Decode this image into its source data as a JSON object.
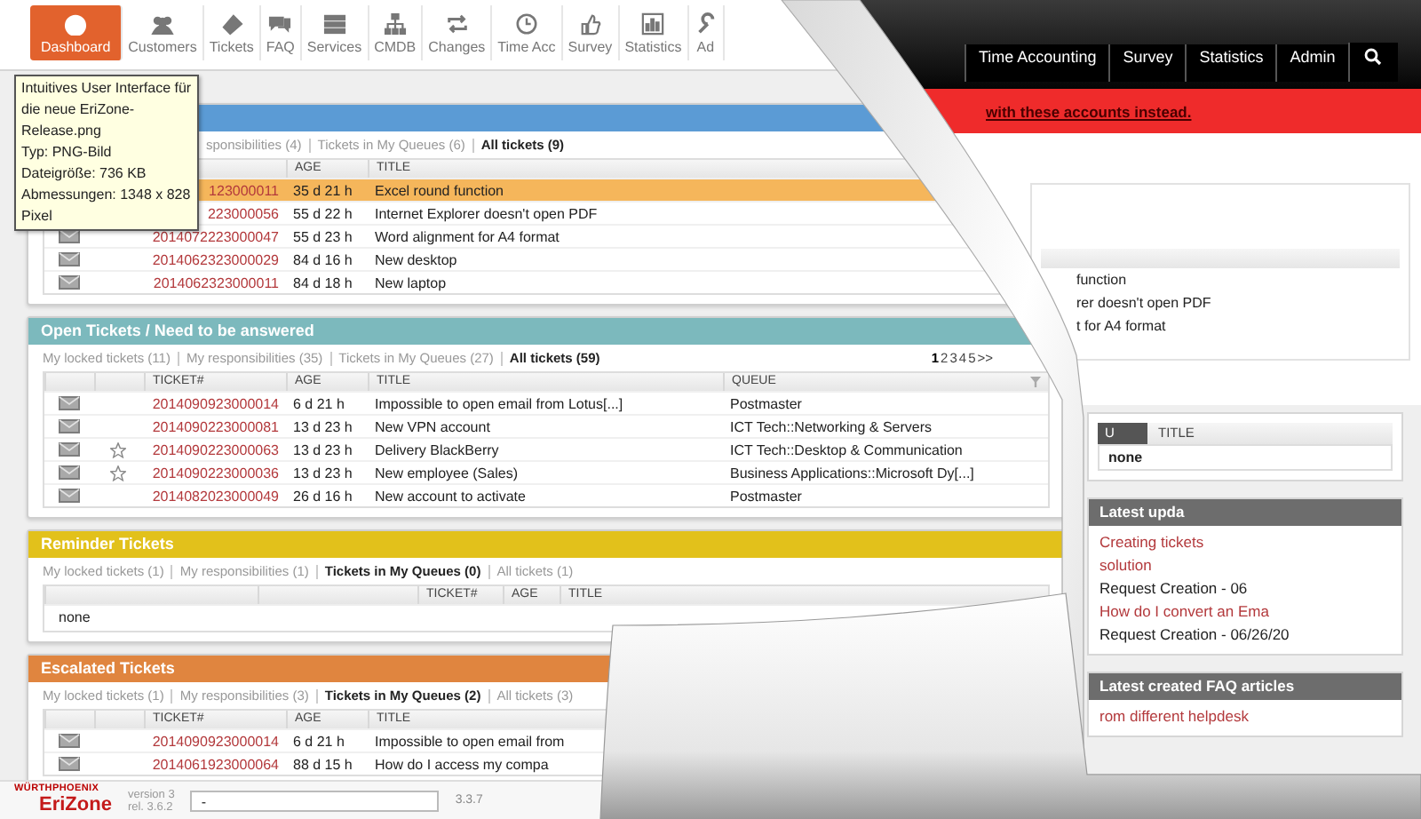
{
  "toolbar": {
    "items": [
      {
        "label": "Dashboard",
        "selected": true
      },
      {
        "label": "Customers",
        "selected": false
      },
      {
        "label": "Tickets",
        "selected": false
      },
      {
        "label": "FAQ",
        "selected": false
      },
      {
        "label": "Services",
        "selected": false
      },
      {
        "label": "CMDB",
        "selected": false
      },
      {
        "label": "Changes",
        "selected": false
      },
      {
        "label": "Time Acc",
        "selected": false
      },
      {
        "label": "Survey",
        "selected": false
      },
      {
        "label": "Statistics",
        "selected": false
      },
      {
        "label": "Ad",
        "selected": false
      }
    ]
  },
  "tooltip": {
    "lines": [
      "Intuitives User Interface für",
      "die neue EriZone-",
      "Release.png",
      "Typ: PNG-Bild",
      "Dateigröße: 736 KB",
      "Abmessungen: 1348 x 828",
      "Pixel"
    ]
  },
  "panels": [
    {
      "color": "#5b9bd5",
      "filters": [
        {
          "label": "sponsibilities (4)",
          "selected": false
        },
        {
          "label": "Tickets in My Queues (6)",
          "selected": false
        },
        {
          "label": "All tickets (9)",
          "selected": true
        }
      ],
      "headers": {
        "age": "AGE",
        "title": "TITLE"
      },
      "rows": [
        {
          "mail": false,
          "star": false,
          "highlighted": true,
          "ticket": "123000011",
          "age": "35 d 21 h",
          "title": "Excel round function"
        },
        {
          "mail": false,
          "star": false,
          "highlighted": false,
          "ticket": "223000056",
          "age": "55 d 22 h",
          "title": "Internet Explorer doesn't open PDF"
        },
        {
          "mail": true,
          "star": false,
          "highlighted": false,
          "ticket": "2014072223000047",
          "age": "55 d 23 h",
          "title": "Word alignment for A4 format"
        },
        {
          "mail": true,
          "star": false,
          "highlighted": false,
          "ticket": "2014062323000029",
          "age": "84 d 16 h",
          "title": "New desktop"
        },
        {
          "mail": true,
          "star": false,
          "highlighted": false,
          "ticket": "2014062323000011",
          "age": "84 d 18 h",
          "title": "New laptop"
        }
      ]
    },
    {
      "title": "Open Tickets / Need to be answered",
      "color": "#7cb9bd",
      "filters": [
        {
          "label": "My locked tickets (11)",
          "selected": false
        },
        {
          "label": "My responsibilities (35)",
          "selected": false
        },
        {
          "label": "Tickets in My Queues (27)",
          "selected": false
        },
        {
          "label": "All tickets (59)",
          "selected": true
        }
      ],
      "pages": [
        {
          "label": "1",
          "selected": true
        },
        {
          "label": "2",
          "selected": false
        },
        {
          "label": "3",
          "selected": false
        },
        {
          "label": "4",
          "selected": false
        },
        {
          "label": "5",
          "selected": false
        },
        {
          "label": ">>",
          "selected": false
        }
      ],
      "headers": {
        "ticket": "TICKET#",
        "age": "AGE",
        "title": "TITLE",
        "queue": "QUEUE"
      },
      "rows": [
        {
          "mail": true,
          "star": false,
          "highlighted": false,
          "ticket": "2014090923000014",
          "age": "6 d 21 h",
          "title": "Impossible to open email from Lotus[...]",
          "queue": "Postmaster"
        },
        {
          "mail": true,
          "star": false,
          "highlighted": false,
          "ticket": "2014090223000081",
          "age": "13 d 23 h",
          "title": "New VPN account",
          "queue": "ICT Tech::Networking & Servers"
        },
        {
          "mail": true,
          "star": true,
          "highlighted": false,
          "ticket": "2014090223000063",
          "age": "13 d 23 h",
          "title": "Delivery BlackBerry",
          "queue": "ICT Tech::Desktop & Communication"
        },
        {
          "mail": true,
          "star": true,
          "highlighted": false,
          "ticket": "2014090223000036",
          "age": "13 d 23 h",
          "title": "New employee (Sales)",
          "queue": "Business Applications::Microsoft Dy[...]"
        },
        {
          "mail": true,
          "star": false,
          "highlighted": false,
          "ticket": "2014082023000049",
          "age": "26 d 16 h",
          "title": "New account to activate",
          "queue": "Postmaster"
        }
      ]
    },
    {
      "title": "Reminder Tickets",
      "color": "#e2c11b",
      "filters": [
        {
          "label": "My locked tickets (1)",
          "selected": false
        },
        {
          "label": "My responsibilities (1)",
          "selected": false
        },
        {
          "label": "Tickets in My Queues (0)",
          "selected": true
        },
        {
          "label": "All tickets (1)",
          "selected": false
        }
      ],
      "headers": {
        "ticket": "TICKET#",
        "age": "AGE",
        "title": "TITLE"
      },
      "empty": "none"
    },
    {
      "title": "Escalated Tickets",
      "color": "#e0853f",
      "filters": [
        {
          "label": "My locked tickets (1)",
          "selected": false
        },
        {
          "label": "My responsibilities (3)",
          "selected": false
        },
        {
          "label": "Tickets in My Queues (2)",
          "selected": true
        },
        {
          "label": "All tickets (3)",
          "selected": false
        }
      ],
      "headers": {
        "ticket": "TICKET#",
        "age": "AGE",
        "title": "TITLE"
      },
      "rows": [
        {
          "mail": true,
          "star": false,
          "highlighted": false,
          "ticket": "2014090923000014",
          "age": "6 d 21 h",
          "title": "Impossible to open email from"
        },
        {
          "mail": true,
          "star": false,
          "highlighted": false,
          "ticket": "2014061923000064",
          "age": "88 d 15 h",
          "title": "How do I access my compa"
        }
      ]
    }
  ],
  "old_ui": {
    "nav": [
      "Time Accounting",
      "Survey",
      "Statistics",
      "Admin"
    ],
    "banner": "with these accounts instead.",
    "rows": [
      "function",
      "rer doesn't open PDF",
      "t for A4 format"
    ]
  },
  "sidebar": [
    {
      "kind": "table",
      "headers": [
        "U",
        "TITLE"
      ],
      "empty": "none"
    },
    {
      "kind": "list",
      "title": "Latest upda",
      "items": [
        {
          "kind": "link",
          "text": "Creating tickets"
        },
        {
          "kind": "link",
          "text": "solution"
        },
        {
          "kind": "meta",
          "text": "Request Creation - 06"
        },
        {
          "kind": "link",
          "text": "How do I convert an Ema"
        },
        {
          "kind": "meta",
          "text": "Request Creation - 06/26/20"
        }
      ]
    },
    {
      "kind": "list",
      "title": "Latest created FAQ articles",
      "items": [
        {
          "kind": "link",
          "text": "rom different helpdesk"
        }
      ]
    }
  ],
  "footer": {
    "brand": "WÜRTHPHOENIX",
    "product": "EriZone",
    "version": "version 3",
    "release": "rel. 3.6.2",
    "field_value": "-",
    "build": "3.3.7"
  }
}
